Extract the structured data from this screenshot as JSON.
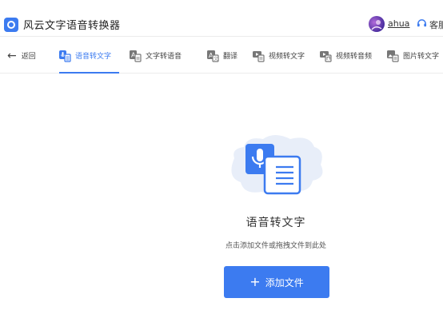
{
  "app": {
    "title": "风云文字语音转换器",
    "user_name": "ahua",
    "service_label": "客服"
  },
  "tabs": [
    {
      "label": "返回",
      "icon": "back-arrow-icon"
    },
    {
      "label": "语音转文字",
      "icon": "voice-to-text-icon",
      "active": true
    },
    {
      "label": "文字转语音",
      "icon": "text-to-voice-icon"
    },
    {
      "label": "翻译",
      "icon": "translate-icon"
    },
    {
      "label": "视频转文字",
      "icon": "video-to-text-icon"
    },
    {
      "label": "视频转音频",
      "icon": "video-to-audio-icon"
    },
    {
      "label": "图片转文字",
      "icon": "image-to-text-icon"
    }
  ],
  "main": {
    "heading": "语音转文字",
    "hint": "点击添加文件或拖拽文件到此处",
    "add_button_label": "添加文件"
  },
  "colors": {
    "accent": "#3c7bf0",
    "illustration_bg": "#e8eef9"
  }
}
